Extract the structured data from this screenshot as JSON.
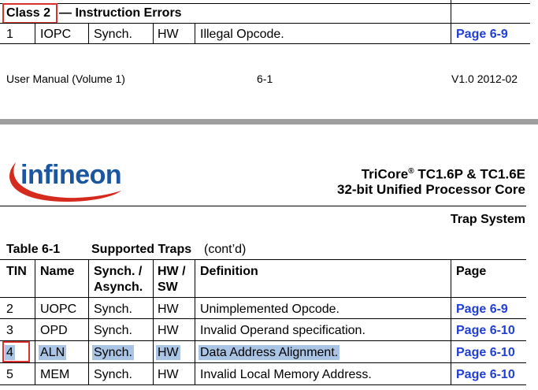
{
  "top": {
    "class_label": "Class 2",
    "class_title": "— Instruction Errors",
    "row": {
      "tin": "1",
      "name": "IOPC",
      "sync": "Synch.",
      "hw": "HW",
      "definition": "Illegal Opcode.",
      "page": "Page 6-9"
    }
  },
  "footer": {
    "left": "User Manual (Volume 1)",
    "center": "6-1",
    "right": "V1.0 2012-02"
  },
  "header": {
    "logo_text": "infineon",
    "product_line1": "TriCore",
    "product_reg": "®",
    "product_line1_rest": " TC1.6P & TC1.6E",
    "product_line2": "32-bit Unified Processor Core",
    "section": "Trap System"
  },
  "table": {
    "caption_num": "Table 6-1",
    "caption_title": "Supported Traps",
    "caption_cont": "(cont’d)",
    "headers": {
      "tin": "TIN",
      "name": "Name",
      "sync_line1": "Synch. /",
      "sync_line2": "Asynch.",
      "hw_line1": "HW /",
      "hw_line2": "SW",
      "definition": "Definition",
      "page": "Page"
    },
    "rows": [
      {
        "tin": "2",
        "name": "UOPC",
        "sync": "Synch.",
        "hw": "HW",
        "definition": "Unimplemented Opcode.",
        "page": "Page 6-9"
      },
      {
        "tin": "3",
        "name": "OPD",
        "sync": "Synch.",
        "hw": "HW",
        "definition": "Invalid Operand specification.",
        "page": "Page 6-10"
      },
      {
        "tin": "4",
        "name": "ALN",
        "sync": "Synch.",
        "hw": "HW",
        "definition": "Data Address Alignment.",
        "page": "Page 6-10"
      },
      {
        "tin": "5",
        "name": "MEM",
        "sync": "Synch.",
        "hw": "HW",
        "definition": "Invalid Local Memory Address.",
        "page": "Page 6-10"
      }
    ]
  },
  "colors": {
    "link": "#1f3fd6",
    "highlight": "#a9c4e4",
    "annotation": "#d9322b",
    "logo": "#1c56a0",
    "swoosh": "#d52b1e"
  }
}
